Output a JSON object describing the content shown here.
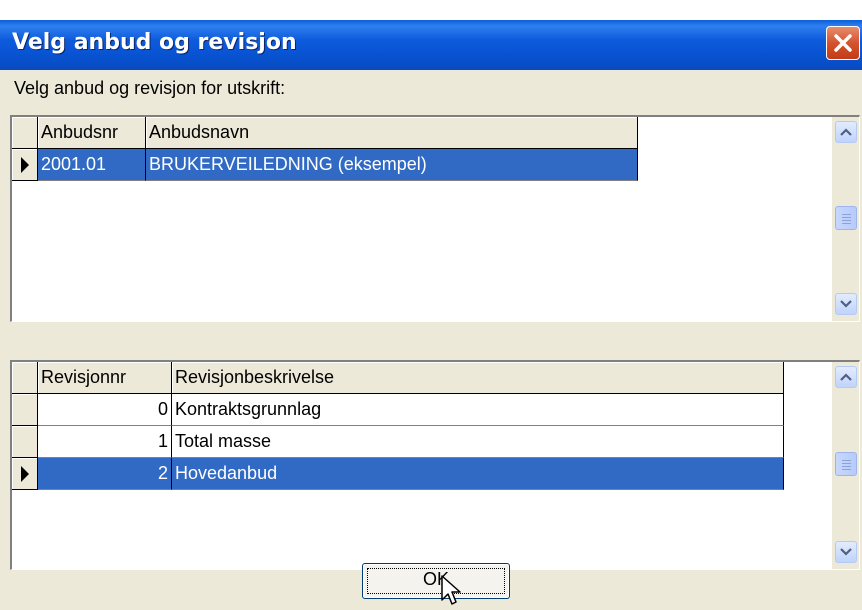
{
  "window": {
    "title": "Velg anbud og revisjon",
    "prompt": "Velg anbud og revisjon for utskrift:",
    "close_symbol": "×"
  },
  "anbud_table": {
    "columns": [
      "Anbudsnr",
      "Anbudsnavn"
    ],
    "rows": [
      {
        "nr": "2001.01",
        "navn": "BRUKERVEILEDNING (eksempel)",
        "selected": true
      }
    ]
  },
  "revisjon_table": {
    "columns": [
      "Revisjonnr",
      "Revisjonbeskrivelse"
    ],
    "rows": [
      {
        "nr": "0",
        "beskrivelse": "Kontraktsgrunnlag",
        "selected": false
      },
      {
        "nr": "1",
        "beskrivelse": "Total masse",
        "selected": false
      },
      {
        "nr": "2",
        "beskrivelse": "Hovedanbud",
        "selected": true
      }
    ]
  },
  "buttons": {
    "ok_label": "OK"
  },
  "colors": {
    "title_bar": "#0853d2",
    "selection": "#316ac5",
    "dialog_bg": "#ece9d8"
  },
  "icons": [
    "close-icon",
    "scroll-up-icon",
    "scroll-down-icon",
    "row-pointer-icon",
    "mouse-cursor-icon"
  ]
}
